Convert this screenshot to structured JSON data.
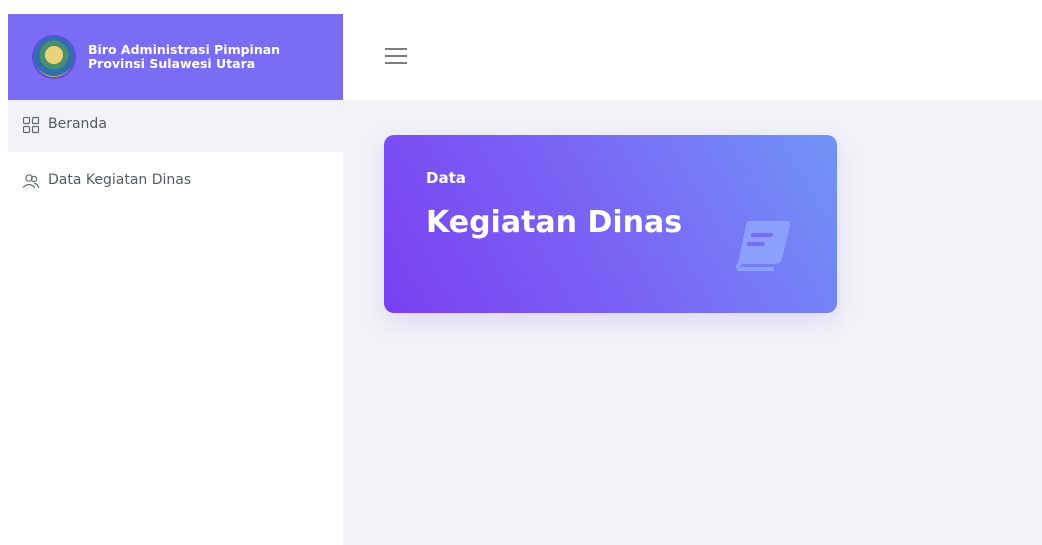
{
  "brand": {
    "line1": "Biro Administrasi Pimpinan",
    "line2": "Provinsi Sulawesi Utara"
  },
  "sidebar": {
    "items": [
      {
        "label": "Beranda",
        "icon": "grid-icon",
        "active": true
      },
      {
        "label": "Data Kegiatan Dinas",
        "icon": "users-icon",
        "active": false
      }
    ]
  },
  "card": {
    "kicker": "Data",
    "title": "Kegiatan Dinas",
    "icon": "book-icon"
  },
  "colors": {
    "brand": "#7a6cf5",
    "card_gradient_start": "#7b3ff2",
    "card_gradient_end": "#7094f6",
    "main_bg": "#f2f2f7"
  }
}
